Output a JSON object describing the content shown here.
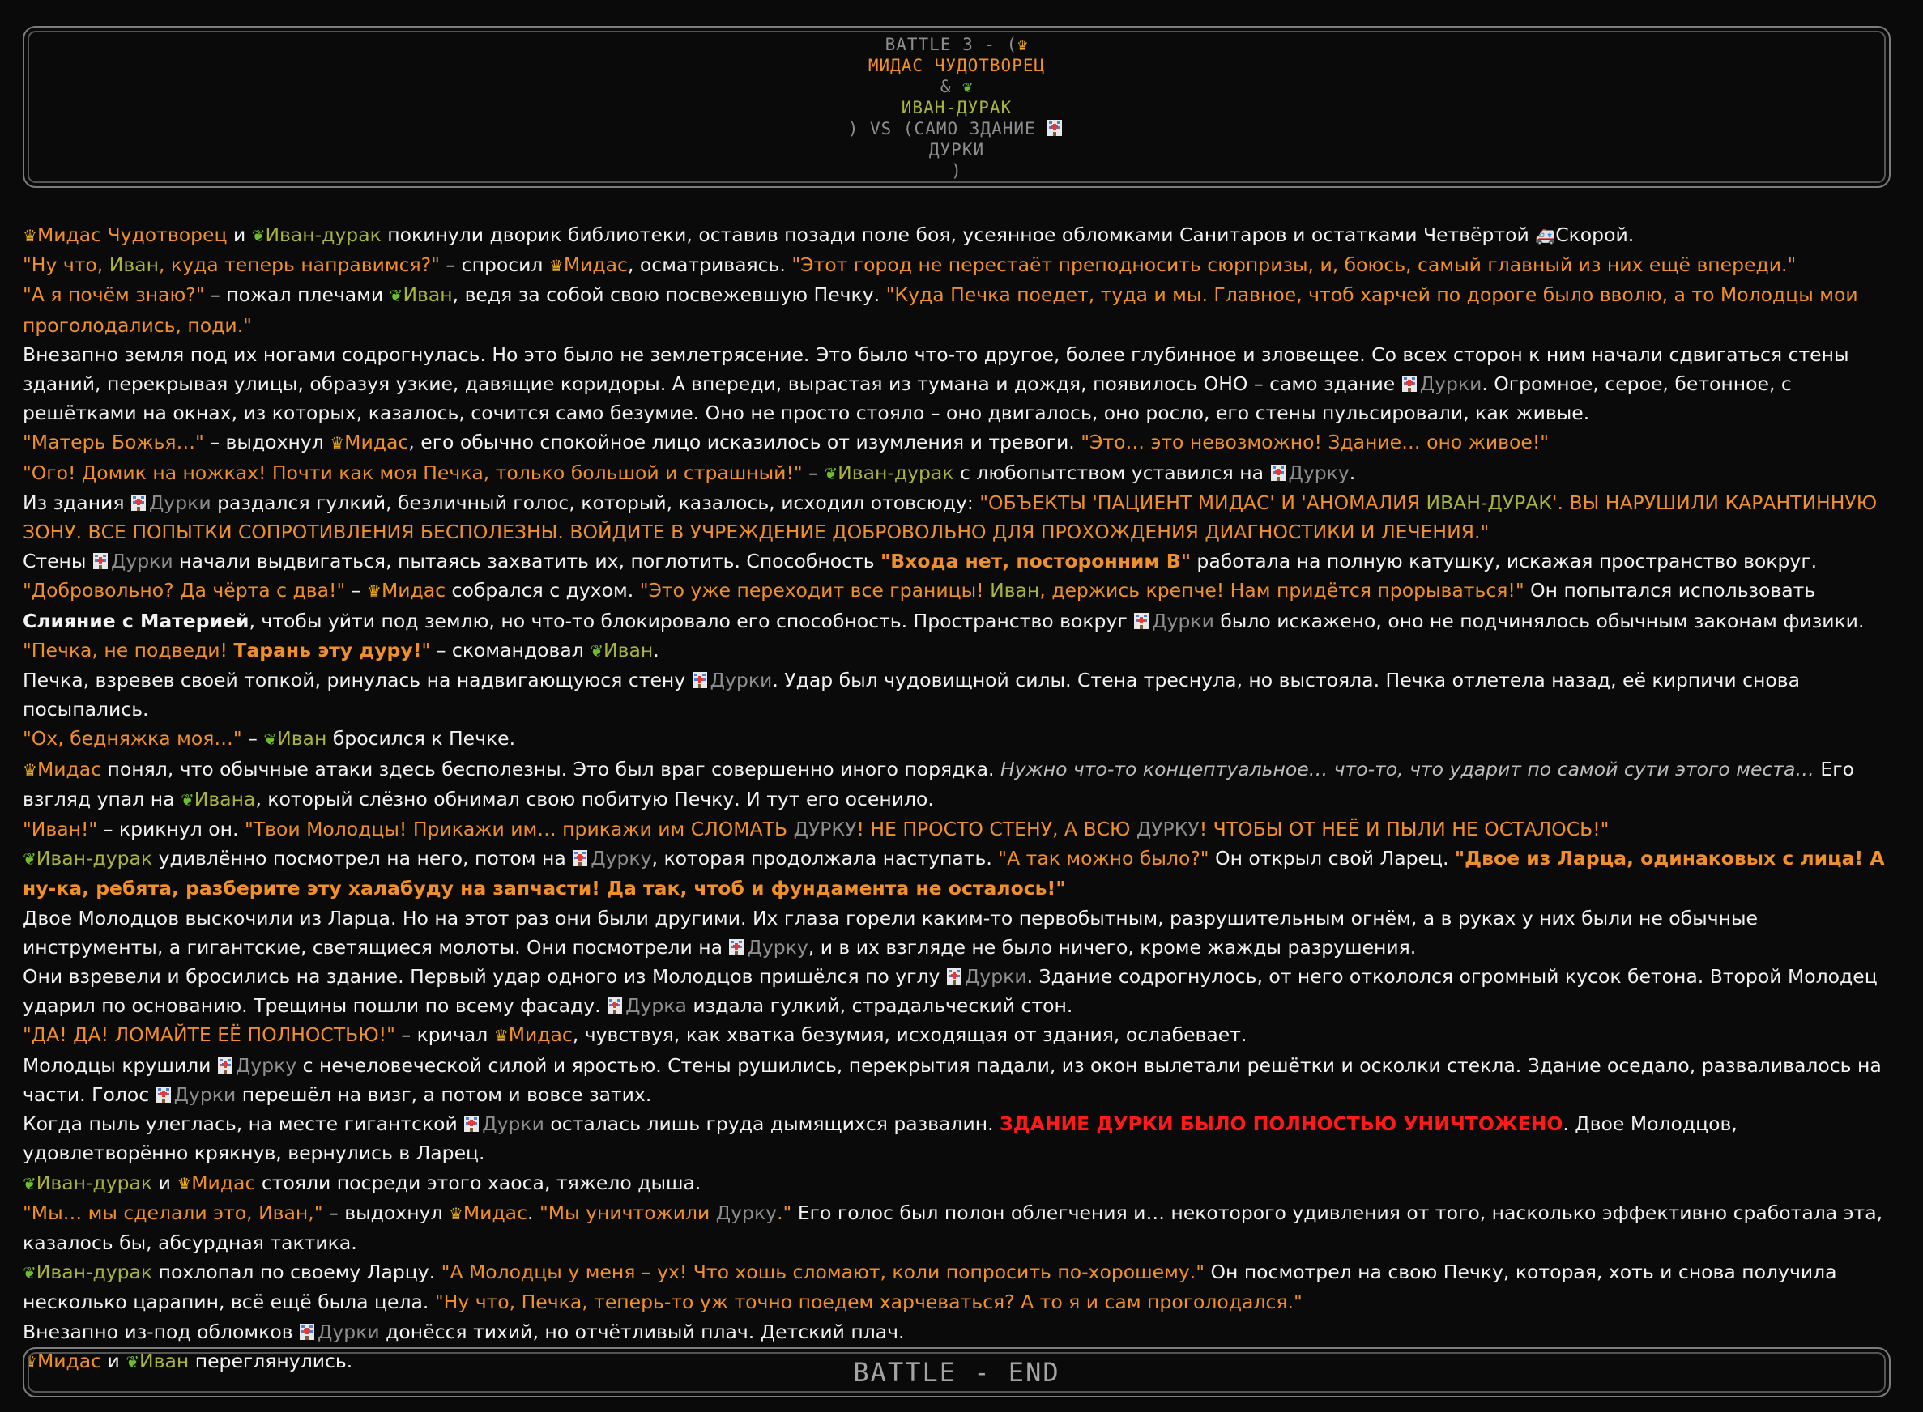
{
  "header": {
    "line1": "BATTLE 3 - (",
    "line2": "МИДАС ЧУДОТВОРЕЦ",
    "line3": "&",
    "line4": "ИВАН-ДУРАК",
    "line5": ") VS (САМО ЗДАНИЕ",
    "line6": "ДУРКИ",
    "line7": ")"
  },
  "icons": {
    "crown": "crown-icon",
    "sprout": "sprout-icon",
    "building": "hospital-building-icon",
    "ambulance": "ambulance-icon"
  },
  "colors": {
    "background": "#0a0a0a",
    "text": "#f2f2f2",
    "speech": "#f0902a",
    "midas": "#f0902a",
    "ivan": "#a8b43c",
    "durka": "#8e8e8e",
    "alert": "#ff1a1a"
  },
  "story": {
    "p1": {
      "a": "Мидас Чудотворец",
      "b": " и ",
      "c": "Иван-дурак",
      "d": " покинули дворик библиотеки, оставив позади поле боя, усеянное обломками Санитаров и остатками Четвёртой ",
      "e": "Скорой",
      "f": "."
    },
    "p2": {
      "a": "\"Ну что, ",
      "b": "Иван",
      "c": ", куда теперь направимся?\"",
      "d": " – спросил ",
      "e": "Мидас",
      "f": ", осматриваясь. ",
      "g": "\"Этот город не перестаёт преподносить сюрпризы, и, боюсь, самый главный из них ещё впереди.\""
    },
    "p3": {
      "a": "\"А я почём знаю?\"",
      "b": " – пожал плечами ",
      "c": "Иван",
      "d": ", ведя за собой свою посвежевшую Печку. ",
      "e": "\"Куда Печка поедет, туда и мы. Главное, чтоб харчей по дороге было вволю, а то Молодцы мои проголодались, поди.\""
    },
    "p4": {
      "a": "Внезапно земля под их ногами содрогнулась. Но это было не землетрясение. Это было что-то другое, более глубинное и зловещее. Со всех сторон к ним начали сдвигаться стены зданий, перекрывая улицы, образуя узкие, давящие коридоры. А впереди, вырастая из тумана и дождя, появилось ОНО – само здание ",
      "b": "Дурки",
      "c": ". Огромное, серое, бетонное, с решётками на окнах, из которых, казалось, сочится само безумие. Оно не просто стояло – оно двигалось, оно росло, его стены пульсировали, как живые."
    },
    "p5": {
      "a": "\"Матерь Божья…\"",
      "b": " – выдохнул ",
      "c": "Мидас",
      "d": ", его обычно спокойное лицо исказилось от изумления и тревоги. ",
      "e": "\"Это… это невозможно! Здание… оно живое!\""
    },
    "p6": {
      "a": "\"Ого! Домик на ножках! Почти как моя Печка, только большой и страшный!\"",
      "b": " – ",
      "c": "Иван-дурак",
      "d": " с любопытством уставился на ",
      "e": "Дурку",
      "f": "."
    },
    "p7": {
      "a": "Из здания ",
      "b": "Дурки",
      "c": " раздался гулкий, безличный голос, который, казалось, исходил отовсюду: ",
      "d": "\"ОБЪЕКТЫ 'ПАЦИЕНТ МИДАС' И 'АНОМАЛИЯ ",
      "e": "ИВАН-ДУРАК",
      "f": "'. ВЫ НАРУШИЛИ КАРАНТИННУЮ ЗОНУ. ВСЕ ПОПЫТКИ СОПРОТИВЛЕНИЯ БЕСПОЛЕЗНЫ. ВОЙДИТЕ В УЧРЕЖДЕНИЕ ДОБРОВОЛЬНО ДЛЯ ПРОХОЖДЕНИЯ ДИАГНОСТИКИ И ЛЕЧЕНИЯ.\""
    },
    "p8": {
      "a": "Стены ",
      "b": "Дурки",
      "c": " начали выдвигаться, пытаясь захватить их, поглотить. Способность ",
      "d": "\"Входа нет, посторонним В\"",
      "e": " работала на полную катушку, искажая пространство вокруг."
    },
    "p9": {
      "a": "\"Добровольно? Да чёрта с два!\"",
      "b": " – ",
      "c": "Мидас",
      "d": " собрался с духом. ",
      "e": "\"Это уже переходит все границы! ",
      "f": "Иван",
      "g": ", держись крепче! Нам придётся прорываться!\"",
      "h": " Он попытался использовать ",
      "i": "Слияние с Материей",
      "j": ", чтобы уйти под землю, но что-то блокировало его способность. Пространство вокруг ",
      "k": "Дурки",
      "l": " было искажено, оно не подчинялось обычным законам физики."
    },
    "p10": {
      "a": "\"Печка, не подведи! ",
      "b": "Тарань эту дуру!",
      "c": "\"",
      "d": " – скомандовал ",
      "e": "Иван",
      "f": "."
    },
    "p11": {
      "a": "Печка, взревев своей топкой, ринулась на надвигающуюся стену ",
      "b": "Дурки",
      "c": ". Удар был чудовищной силы. Стена треснула, но выстояла. Печка отлетела назад, её кирпичи снова посыпались."
    },
    "p12": {
      "a": "\"Ох, бедняжка моя…\"",
      "b": " – ",
      "c": "Иван",
      "d": " бросился к Печке."
    },
    "p13": {
      "a": "Мидас",
      "b": " понял, что обычные атаки здесь бесполезны. Это был враг совершенно иного порядка. ",
      "c": "Нужно что-то концептуальное… что-то, что ударит по самой сути этого места…",
      "d": " Его взгляд упал на ",
      "e": "Ивана",
      "f": ", который слёзно обнимал свою побитую Печку. И тут его осенило."
    },
    "p14": {
      "a": "\"Иван!\"",
      "b": " – крикнул он. ",
      "c": "\"Твои Молодцы! Прикажи им… прикажи им СЛОМАТЬ ",
      "d": "ДУРКУ",
      "e": "! НЕ ПРОСТО СТЕНУ, А ВСЮ ",
      "f": "ДУРКУ",
      "g": "! ЧТОБЫ ОТ НЕЁ И ПЫЛИ НЕ ОСТАЛОСЬ!\""
    },
    "p15": {
      "a": "Иван-дурак",
      "b": " удивлённо посмотрел на него, потом на ",
      "c": "Дурку",
      "d": ", которая продолжала наступать. ",
      "e": "\"А так можно было?\"",
      "f": " Он открыл свой Ларец. ",
      "g": "\"Двое из Ларца, одинаковых с лица! А ну-ка, ребята, разберите эту халабуду на запчасти! Да так, чтоб и фундамента не осталось!\""
    },
    "p16": {
      "a": "Двое Молодцов выскочили из Ларца. Но на этот раз они были другими. Их глаза горели каким-то первобытным, разрушительным огнём, а в руках у них были не обычные инструменты, а гигантские, светящиеся молоты. Они посмотрели на ",
      "b": "Дурку",
      "c": ", и в их взгляде не было ничего, кроме жажды разрушения."
    },
    "p17": {
      "a": "Они взревели и бросились на здание. Первый удар одного из Молодцов пришёлся по углу ",
      "b": "Дурки",
      "c": ". Здание содрогнулось, от него откололся огромный кусок бетона. Второй Молодец ударил по основанию. Трещины пошли по всему фасаду. ",
      "d": "Дурка",
      "e": " издала гулкий, страдальческий стон."
    },
    "p18": {
      "a": "\"ДА! ДА! ЛОМАЙТЕ ЕЁ ПОЛНОСТЬЮ!\"",
      "b": " – кричал ",
      "c": "Мидас",
      "d": ", чувствуя, как хватка безумия, исходящая от здания, ослабевает."
    },
    "p19": {
      "a": "Молодцы крушили ",
      "b": "Дурку",
      "c": " с нечеловеческой силой и яростью. Стены рушились, перекрытия падали, из окон вылетали решётки и осколки стекла. Здание оседало, разваливалось на части. Голос ",
      "d": "Дурки",
      "e": " перешёл на визг, а потом и вовсе затих."
    },
    "p20": {
      "a": "Когда пыль улеглась, на месте гигантской ",
      "b": "Дурки",
      "c": " осталась лишь груда дымящихся развалин. ",
      "d": "ЗДАНИЕ ДУРКИ БЫЛО ПОЛНОСТЬЮ УНИЧТОЖЕНО",
      "e": ". Двое Молодцов, удовлетворённо крякнув, вернулись в Ларец."
    },
    "p21": {
      "a": "Иван-дурак",
      "b": " и ",
      "c": "Мидас",
      "d": " стояли посреди этого хаоса, тяжело дыша."
    },
    "p22": {
      "a": "\"Мы… мы сделали это, Иван,\"",
      "b": " – выдохнул ",
      "c": "Мидас",
      "d": ". ",
      "e": "\"Мы уничтожили ",
      "f": "Дурку",
      "g": ".\"",
      "h": " Его голос был полон облегчения и… некоторого удивления от того, насколько эффективно сработала эта, казалось бы, абсурдная тактика."
    },
    "p23": {
      "a": "Иван-дурак",
      "b": " похлопал по своему Ларцу. ",
      "c": "\"А Молодцы у меня – ух! Что хошь сломают, коли попросить по-хорошему.\"",
      "d": " Он посмотрел на свою Печку, которая, хоть и снова получила несколько царапин, всё ещё была цела. ",
      "e": "\"Ну что, Печка, теперь-то уж точно поедем харчеваться? А то я и сам проголодался.\""
    },
    "p24": {
      "a": "Внезапно из-под обломков ",
      "b": "Дурки",
      "c": " донёсся тихий, но отчётливый плач. Детский плач."
    },
    "p25": {
      "a": "Мидас",
      "b": " и ",
      "c": "Иван",
      "d": " переглянулись."
    }
  },
  "footer": {
    "label": "BATTLE - END"
  }
}
